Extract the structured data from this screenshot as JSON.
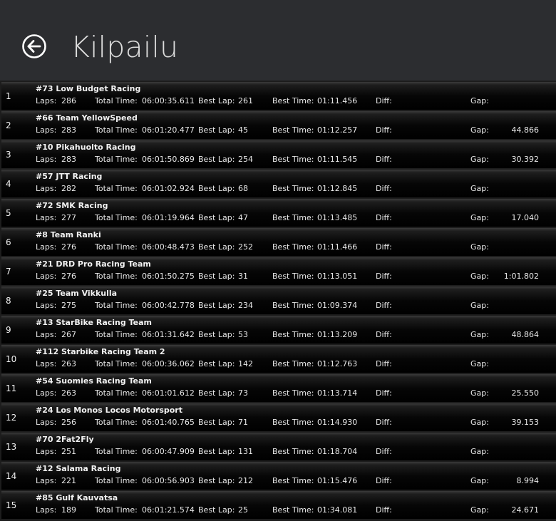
{
  "header": {
    "title": "Kilpailu",
    "back_icon": "back-arrow-icon"
  },
  "labels": {
    "laps": "Laps:",
    "total_time": "Total Time:",
    "best_lap": "Best Lap:",
    "best_time": "Best Time:",
    "diff": "Diff:",
    "gap": "Gap:"
  },
  "results": [
    {
      "pos": "1",
      "team": "#73 Low Budget Racing",
      "laps": "286",
      "total_time": "06:00:35.611",
      "best_lap": "261",
      "best_time": "01:11.456",
      "diff": "",
      "gap": ""
    },
    {
      "pos": "2",
      "team": "#66 Team YellowSpeed",
      "laps": "283",
      "total_time": "06:01:20.477",
      "best_lap": "45",
      "best_time": "01:12.257",
      "diff": "",
      "gap": "44.866"
    },
    {
      "pos": "3",
      "team": "#10 Pikahuolto Racing",
      "laps": "283",
      "total_time": "06:01:50.869",
      "best_lap": "254",
      "best_time": "01:11.545",
      "diff": "",
      "gap": "30.392"
    },
    {
      "pos": "4",
      "team": "#57 JTT Racing",
      "laps": "282",
      "total_time": "06:01:02.924",
      "best_lap": "68",
      "best_time": "01:12.845",
      "diff": "",
      "gap": ""
    },
    {
      "pos": "5",
      "team": "#72 SMK Racing",
      "laps": "277",
      "total_time": "06:01:19.964",
      "best_lap": "47",
      "best_time": "01:13.485",
      "diff": "",
      "gap": "17.040"
    },
    {
      "pos": "6",
      "team": "#8 Team Ranki",
      "laps": "276",
      "total_time": "06:00:48.473",
      "best_lap": "252",
      "best_time": "01:11.466",
      "diff": "",
      "gap": ""
    },
    {
      "pos": "7",
      "team": "#21 DRD Pro Racing Team",
      "laps": "276",
      "total_time": "06:01:50.275",
      "best_lap": "31",
      "best_time": "01:13.051",
      "diff": "",
      "gap": "1:01.802"
    },
    {
      "pos": "8",
      "team": "#25 Team Vikkulla",
      "laps": "275",
      "total_time": "06:00:42.778",
      "best_lap": "234",
      "best_time": "01:09.374",
      "diff": "",
      "gap": ""
    },
    {
      "pos": "9",
      "team": "#13 StarBike Racing Team",
      "laps": "267",
      "total_time": "06:01:31.642",
      "best_lap": "53",
      "best_time": "01:13.209",
      "diff": "",
      "gap": "48.864"
    },
    {
      "pos": "10",
      "team": "#112 Starbike Racing Team 2",
      "laps": "263",
      "total_time": "06:00:36.062",
      "best_lap": "142",
      "best_time": "01:12.763",
      "diff": "",
      "gap": ""
    },
    {
      "pos": "11",
      "team": "#54 Suomies Racing Team",
      "laps": "263",
      "total_time": "06:01:01.612",
      "best_lap": "73",
      "best_time": "01:13.714",
      "diff": "",
      "gap": "25.550"
    },
    {
      "pos": "12",
      "team": "#24 Los Monos Locos Motorsport",
      "laps": "256",
      "total_time": "06:01:40.765",
      "best_lap": "71",
      "best_time": "01:14.930",
      "diff": "",
      "gap": "39.153"
    },
    {
      "pos": "13",
      "team": "#70 2Fat2Fly",
      "laps": "251",
      "total_time": "06:00:47.909",
      "best_lap": "131",
      "best_time": "01:18.704",
      "diff": "",
      "gap": ""
    },
    {
      "pos": "14",
      "team": "#12 Salama Racing",
      "laps": "221",
      "total_time": "06:00:56.903",
      "best_lap": "212",
      "best_time": "01:15.476",
      "diff": "",
      "gap": "8.994"
    },
    {
      "pos": "15",
      "team": "#85 Gulf Kauvatsa",
      "laps": "189",
      "total_time": "06:01:21.574",
      "best_lap": "25",
      "best_time": "01:34.081",
      "diff": "",
      "gap": "24.671"
    }
  ]
}
